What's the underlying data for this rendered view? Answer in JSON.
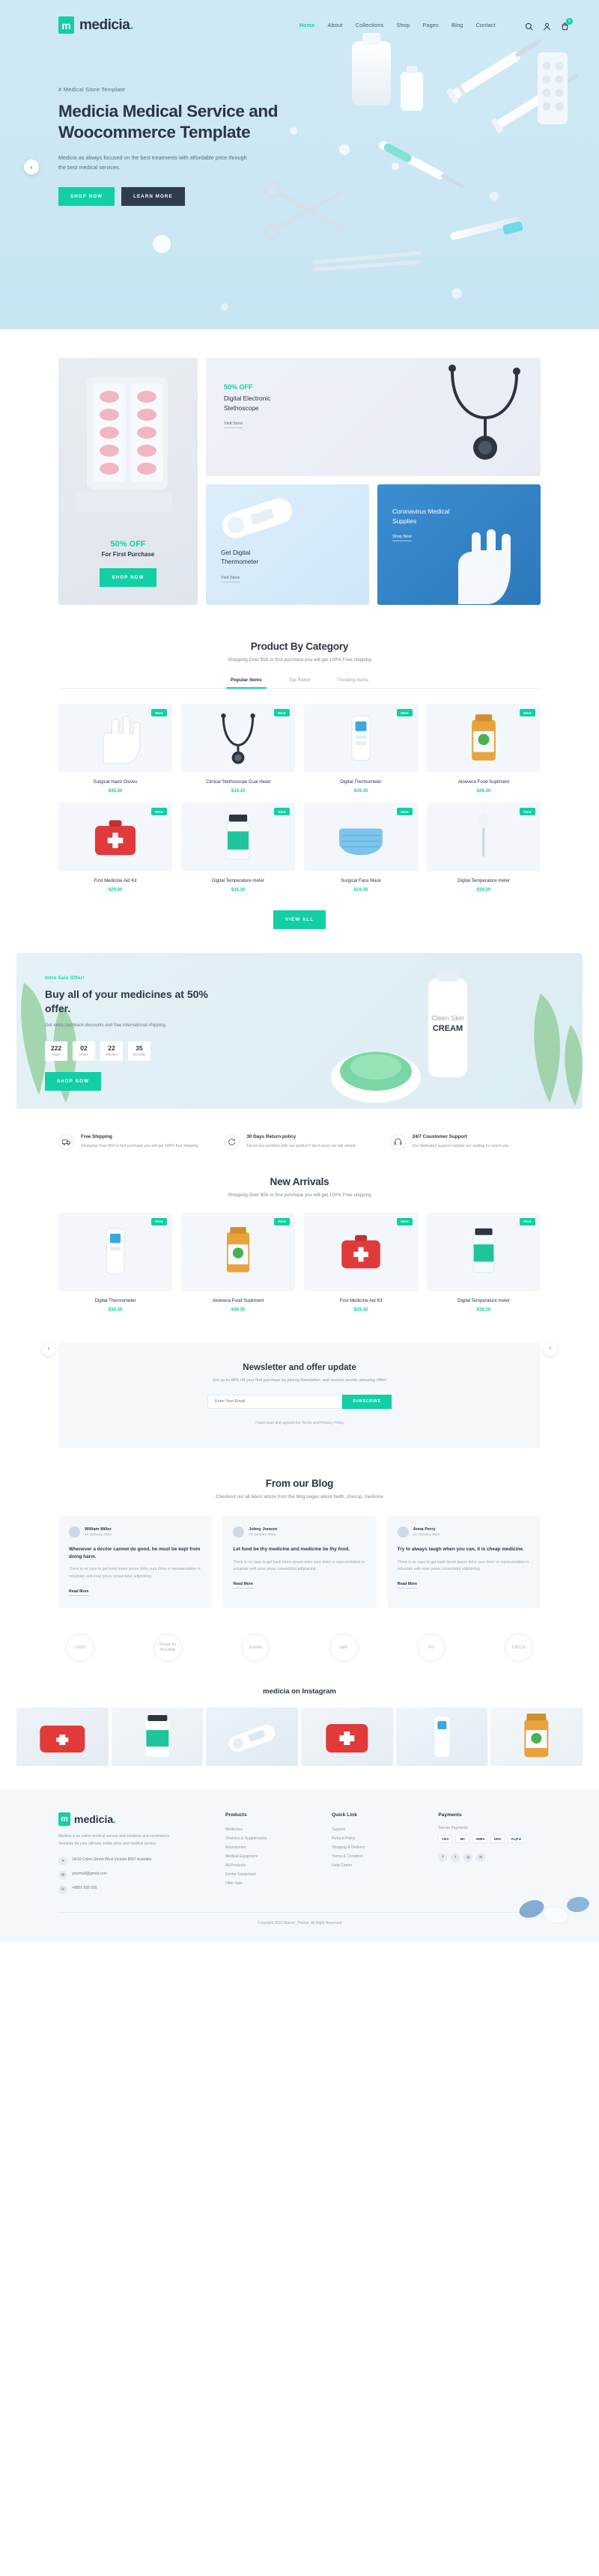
{
  "brand": {
    "mark": "m",
    "name": "medicia",
    "dot": "."
  },
  "nav": {
    "items": [
      {
        "label": "Home",
        "active": true
      },
      {
        "label": "About",
        "active": false
      },
      {
        "label": "Collections",
        "active": false
      },
      {
        "label": "Shop",
        "active": false
      },
      {
        "label": "Pages",
        "active": false
      },
      {
        "label": "Blog",
        "active": false
      },
      {
        "label": "Contact",
        "active": false
      }
    ],
    "icons": [
      {
        "name": "search-icon",
        "glyph": "⌕"
      },
      {
        "name": "user-icon",
        "glyph": "◠"
      },
      {
        "name": "cart-icon",
        "glyph": "▯"
      }
    ],
    "cart_count": "0"
  },
  "hero": {
    "eyebrow": "# Medical Store Template",
    "title_line1": "Medicia Medical Service and",
    "title_line2": "Woocommerce Template",
    "subtitle": "Medicia as always focused on the best treatments with affordable price through the best medical services.",
    "primary_btn": "Shop Now",
    "secondary_btn": "Learn More",
    "prev_arrow": "‹"
  },
  "promo": {
    "left": {
      "percent": "50% OFF",
      "sub": "For First Purchase",
      "btn": "Shop Now"
    },
    "stethoscope": {
      "off": "50% OFF",
      "heading": "Digital Electronic\nStethoscope",
      "link": "Visit Store"
    },
    "thermometer": {
      "heading": "Get Digital\nThermometer",
      "link": "Visit Store"
    },
    "supplies": {
      "heading": "Coronavirus Medical\nSupplies",
      "link": "Shop Now"
    }
  },
  "category": {
    "title": "Product By Category",
    "subtitle": "Shopping Over $59 or first purchase you will get 100% Free shipping",
    "tabs": [
      {
        "label": "Popular Items",
        "active": true
      },
      {
        "label": "Top Rated",
        "active": false
      },
      {
        "label": "Trending Items",
        "active": false
      }
    ],
    "view_all": "View All",
    "products": [
      {
        "name": "Surgical Hand Gloves",
        "price": "$45.30",
        "badge": "New",
        "img": "gloves"
      },
      {
        "name": "Clinical Stethoscope Dual Head",
        "price": "$34.30",
        "badge": "New",
        "img": "stethoscope"
      },
      {
        "name": "Digital Thermometer",
        "price": "$39.30",
        "badge": "New",
        "img": "thermometer"
      },
      {
        "name": "Aloevera Food Supliment",
        "price": "$49.30",
        "badge": "New",
        "img": "supplement"
      },
      {
        "name": "First Medicine Aid Kit",
        "price": "$29.30",
        "badge": "New",
        "img": "aidkit"
      },
      {
        "name": "Digital Temperature meter",
        "price": "$34.30",
        "badge": "New",
        "img": "bottle"
      },
      {
        "name": "Surgical Face Mask",
        "price": "$19.30",
        "badge": "New",
        "img": "mask"
      },
      {
        "name": "Digital Temperature meter",
        "price": "$39.30",
        "badge": "New",
        "img": "swab"
      }
    ]
  },
  "sale": {
    "eyebrow": "Intro Sale Offer!",
    "title": "Buy all of your medicines at 50% offer.",
    "subtitle": "Get extra cashback discounts and free international shipping.",
    "counters": [
      {
        "value": "222",
        "label": "Days"
      },
      {
        "value": "02",
        "label": "Hours"
      },
      {
        "value": "22",
        "label": "Minutes"
      },
      {
        "value": "35",
        "label": "Seconds"
      }
    ],
    "btn": "Shop Now"
  },
  "features": [
    {
      "icon": "truck-icon",
      "glyph": "⛟",
      "title": "Free Shipping",
      "desc": "Shopping Over $59 or first purchase you will get 100% free shipping."
    },
    {
      "icon": "refresh-icon",
      "glyph": "↺",
      "title": "30 Days Return policy",
      "desc": "Faced any problem with our product? don't worry we will refund."
    },
    {
      "icon": "headset-icon",
      "glyph": "☏",
      "title": "24/7 Coustomer Support",
      "desc": "Our dedicated support register are waiting for assist you."
    }
  ],
  "arrivals": {
    "title": "New Arrivals",
    "subtitle": "Shopping Over $59 or first purchase you will get 100% Free shipping",
    "prev": "‹",
    "next": "›",
    "products": [
      {
        "name": "Digital Thermometer",
        "price": "$39.30",
        "badge": "New",
        "img": "thermometer"
      },
      {
        "name": "Aloevera Food Supliment",
        "price": "$49.30",
        "badge": "New",
        "img": "supplement"
      },
      {
        "name": "First Medicine Aid Kit",
        "price": "$29.30",
        "badge": "New",
        "img": "aidkit"
      },
      {
        "name": "Digital Temperature meter",
        "price": "$39.30",
        "badge": "New",
        "img": "bottle"
      }
    ]
  },
  "newsletter": {
    "title": "Newsletter and offer update",
    "subtitle": "Get up to 48% off your first purchase by joining Newsletter, and receive weekly amazing Offer!",
    "placeholder": "Enter Your Email",
    "button": "Subscribe",
    "note": "I have read and agreed the Terms and Privacy Policy"
  },
  "blog": {
    "title": "From our Blog",
    "subtitle": "Checkout our all latest article from the blog pages about helth, checup, medicine",
    "posts": [
      {
        "author": "William Miller",
        "date": "21 January 2022",
        "title": "Whenever a doctor cannot do good, he must be kept from doing harm.",
        "excerpt": "There is no case to get bank lorem ipsum dolor sure dolor or representation in voluptate velit esse press consectetur adipisicing.",
        "link": "Read More"
      },
      {
        "author": "Johny Jonson",
        "date": "21 January 2022",
        "title": "Let food be thy medicine and medicine be thy food.",
        "excerpt": "There is no case to get bank lorem ipsum dolor sure dolor or representation in voluptate velit esse press consectetur adipisicing.",
        "link": "Read More"
      },
      {
        "author": "Anna Perry",
        "date": "21 January 2022",
        "title": "Try to always laugh when you can, it is cheap medicine.",
        "excerpt": "There is no case to get bank lorem ipsum dolor sure dolor or representation in voluptate velit esse press consectetur adipisicing.",
        "link": "Read More"
      }
    ]
  },
  "logos": [
    {
      "text": "LOGO"
    },
    {
      "text": "Design for Branding"
    },
    {
      "text": "Estrella"
    },
    {
      "text": "D&R"
    },
    {
      "text": "PS"
    },
    {
      "text": "CIRCLE"
    }
  ],
  "instagram": {
    "title": "medicia on Instagram"
  },
  "footer": {
    "brand_mark": "m",
    "brand_name": "medicia",
    "brand_dot": ".",
    "desc": "Medicia is an online medical service and medicine and ecommerce Template for your ultimate online store and medical service.",
    "contacts": [
      {
        "icon": "location-icon",
        "glyph": "⌖",
        "text": "14/10 Colins Street West Victoria 8007 Australia"
      },
      {
        "icon": "mail-icon",
        "glyph": "✉",
        "text": "yourmail@gmail.com"
      },
      {
        "icon": "phone-icon",
        "glyph": "☏",
        "text": "+8801 555 655"
      }
    ],
    "columns": [
      {
        "title": "Products",
        "items": [
          "Medicines",
          "Vitamins & Supplements",
          "Accessories",
          "Medical Equipment",
          "All Products",
          "Doctor Equipment",
          "Offer Sale"
        ]
      },
      {
        "title": "Quick Link",
        "items": [
          "Support",
          "Refund Policy",
          "Shipping & Delivery",
          "Terms & Condition",
          "Help Center"
        ]
      }
    ],
    "payments": {
      "title": "Payments",
      "label": "Secure Payments",
      "chips": [
        "VISA",
        "MC",
        "AMEX",
        "DISC",
        "PayPal"
      ]
    },
    "socials": [
      {
        "name": "facebook-icon",
        "glyph": "f"
      },
      {
        "name": "twitter-icon",
        "glyph": "t"
      },
      {
        "name": "instagram-icon",
        "glyph": "◎"
      },
      {
        "name": "linkedin-icon",
        "glyph": "in"
      }
    ],
    "copyright": "Copyright 2022 Marvel_Theme. All Right Reserved"
  }
}
